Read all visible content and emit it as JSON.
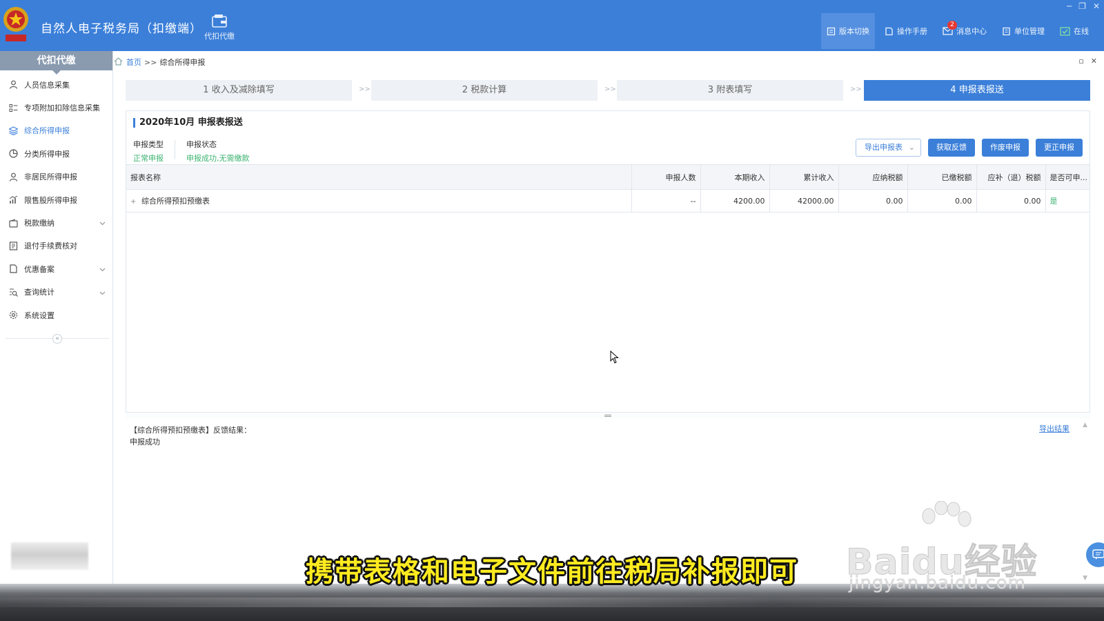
{
  "app": {
    "title": "自然人电子税务局（扣缴端）",
    "module_label": "代扣代缴",
    "tools": [
      {
        "label": "版本切换",
        "icon": "version-icon"
      },
      {
        "label": "操作手册",
        "icon": "manual-icon"
      },
      {
        "label": "消息中心",
        "icon": "mail-icon",
        "badge": "2"
      },
      {
        "label": "单位管理",
        "icon": "building-icon"
      },
      {
        "label": "在线",
        "icon": "online-check-icon"
      }
    ]
  },
  "sidebar": {
    "title": "代扣代缴",
    "items": [
      {
        "label": "人员信息采集",
        "icon": "person-icon"
      },
      {
        "label": "专项附加扣除信息采集",
        "icon": "list-icon"
      },
      {
        "label": "综合所得申报",
        "icon": "layers-icon",
        "active": true
      },
      {
        "label": "分类所得申报",
        "icon": "pie-icon"
      },
      {
        "label": "非居民所得申报",
        "icon": "person-outline-icon"
      },
      {
        "label": "限售股所得申报",
        "icon": "bar-chart-icon"
      },
      {
        "label": "税款缴纳",
        "icon": "wallet-icon",
        "expandable": true
      },
      {
        "label": "退付手续费核对",
        "icon": "document-icon"
      },
      {
        "label": "优惠备案",
        "icon": "file-icon",
        "expandable": true
      },
      {
        "label": "查询统计",
        "icon": "search-list-icon",
        "expandable": true
      },
      {
        "label": "系统设置",
        "icon": "gear-icon"
      }
    ]
  },
  "breadcrumb": {
    "home": "首页",
    "separator": ">>",
    "current": "综合所得申报"
  },
  "steps": [
    {
      "label": "1 收入及减除填写"
    },
    {
      "label": "2 税款计算"
    },
    {
      "label": "3 附表填写"
    },
    {
      "label": "4 申报表报送",
      "active": true
    }
  ],
  "step_separator": ">>",
  "main": {
    "period_title": "2020年10月  申报表报送",
    "meta": {
      "type_label": "申报类型",
      "type_value": "正常申报",
      "status_label": "申报状态",
      "status_value": "申报成功,无需缴款"
    },
    "actions": {
      "export": "导出申报表",
      "feedback": "获取反馈",
      "void": "作废申报",
      "correct": "更正申报"
    },
    "table": {
      "columns": [
        "报表名称",
        "申报人数",
        "本期收入",
        "累计收入",
        "应纳税额",
        "已缴税额",
        "应补（退）税额",
        "是否可申..."
      ],
      "rows": [
        [
          "综合所得预扣预缴表",
          "--",
          "4200.00",
          "42000.00",
          "0.00",
          "0.00",
          "0.00",
          "是"
        ]
      ]
    }
  },
  "result": {
    "line1": "【综合所得预扣预缴表】反馈结果：",
    "line2": "申报成功",
    "export_link": "导出结果"
  },
  "caption": "携带表格和电子文件前往税局补报即可",
  "watermark": {
    "main": "Baidu经验",
    "sub": "jingyan.baidu.com"
  },
  "colors": {
    "primary": "#3b7fd9",
    "success": "#3cb371",
    "caption": "#ffeb1f"
  }
}
